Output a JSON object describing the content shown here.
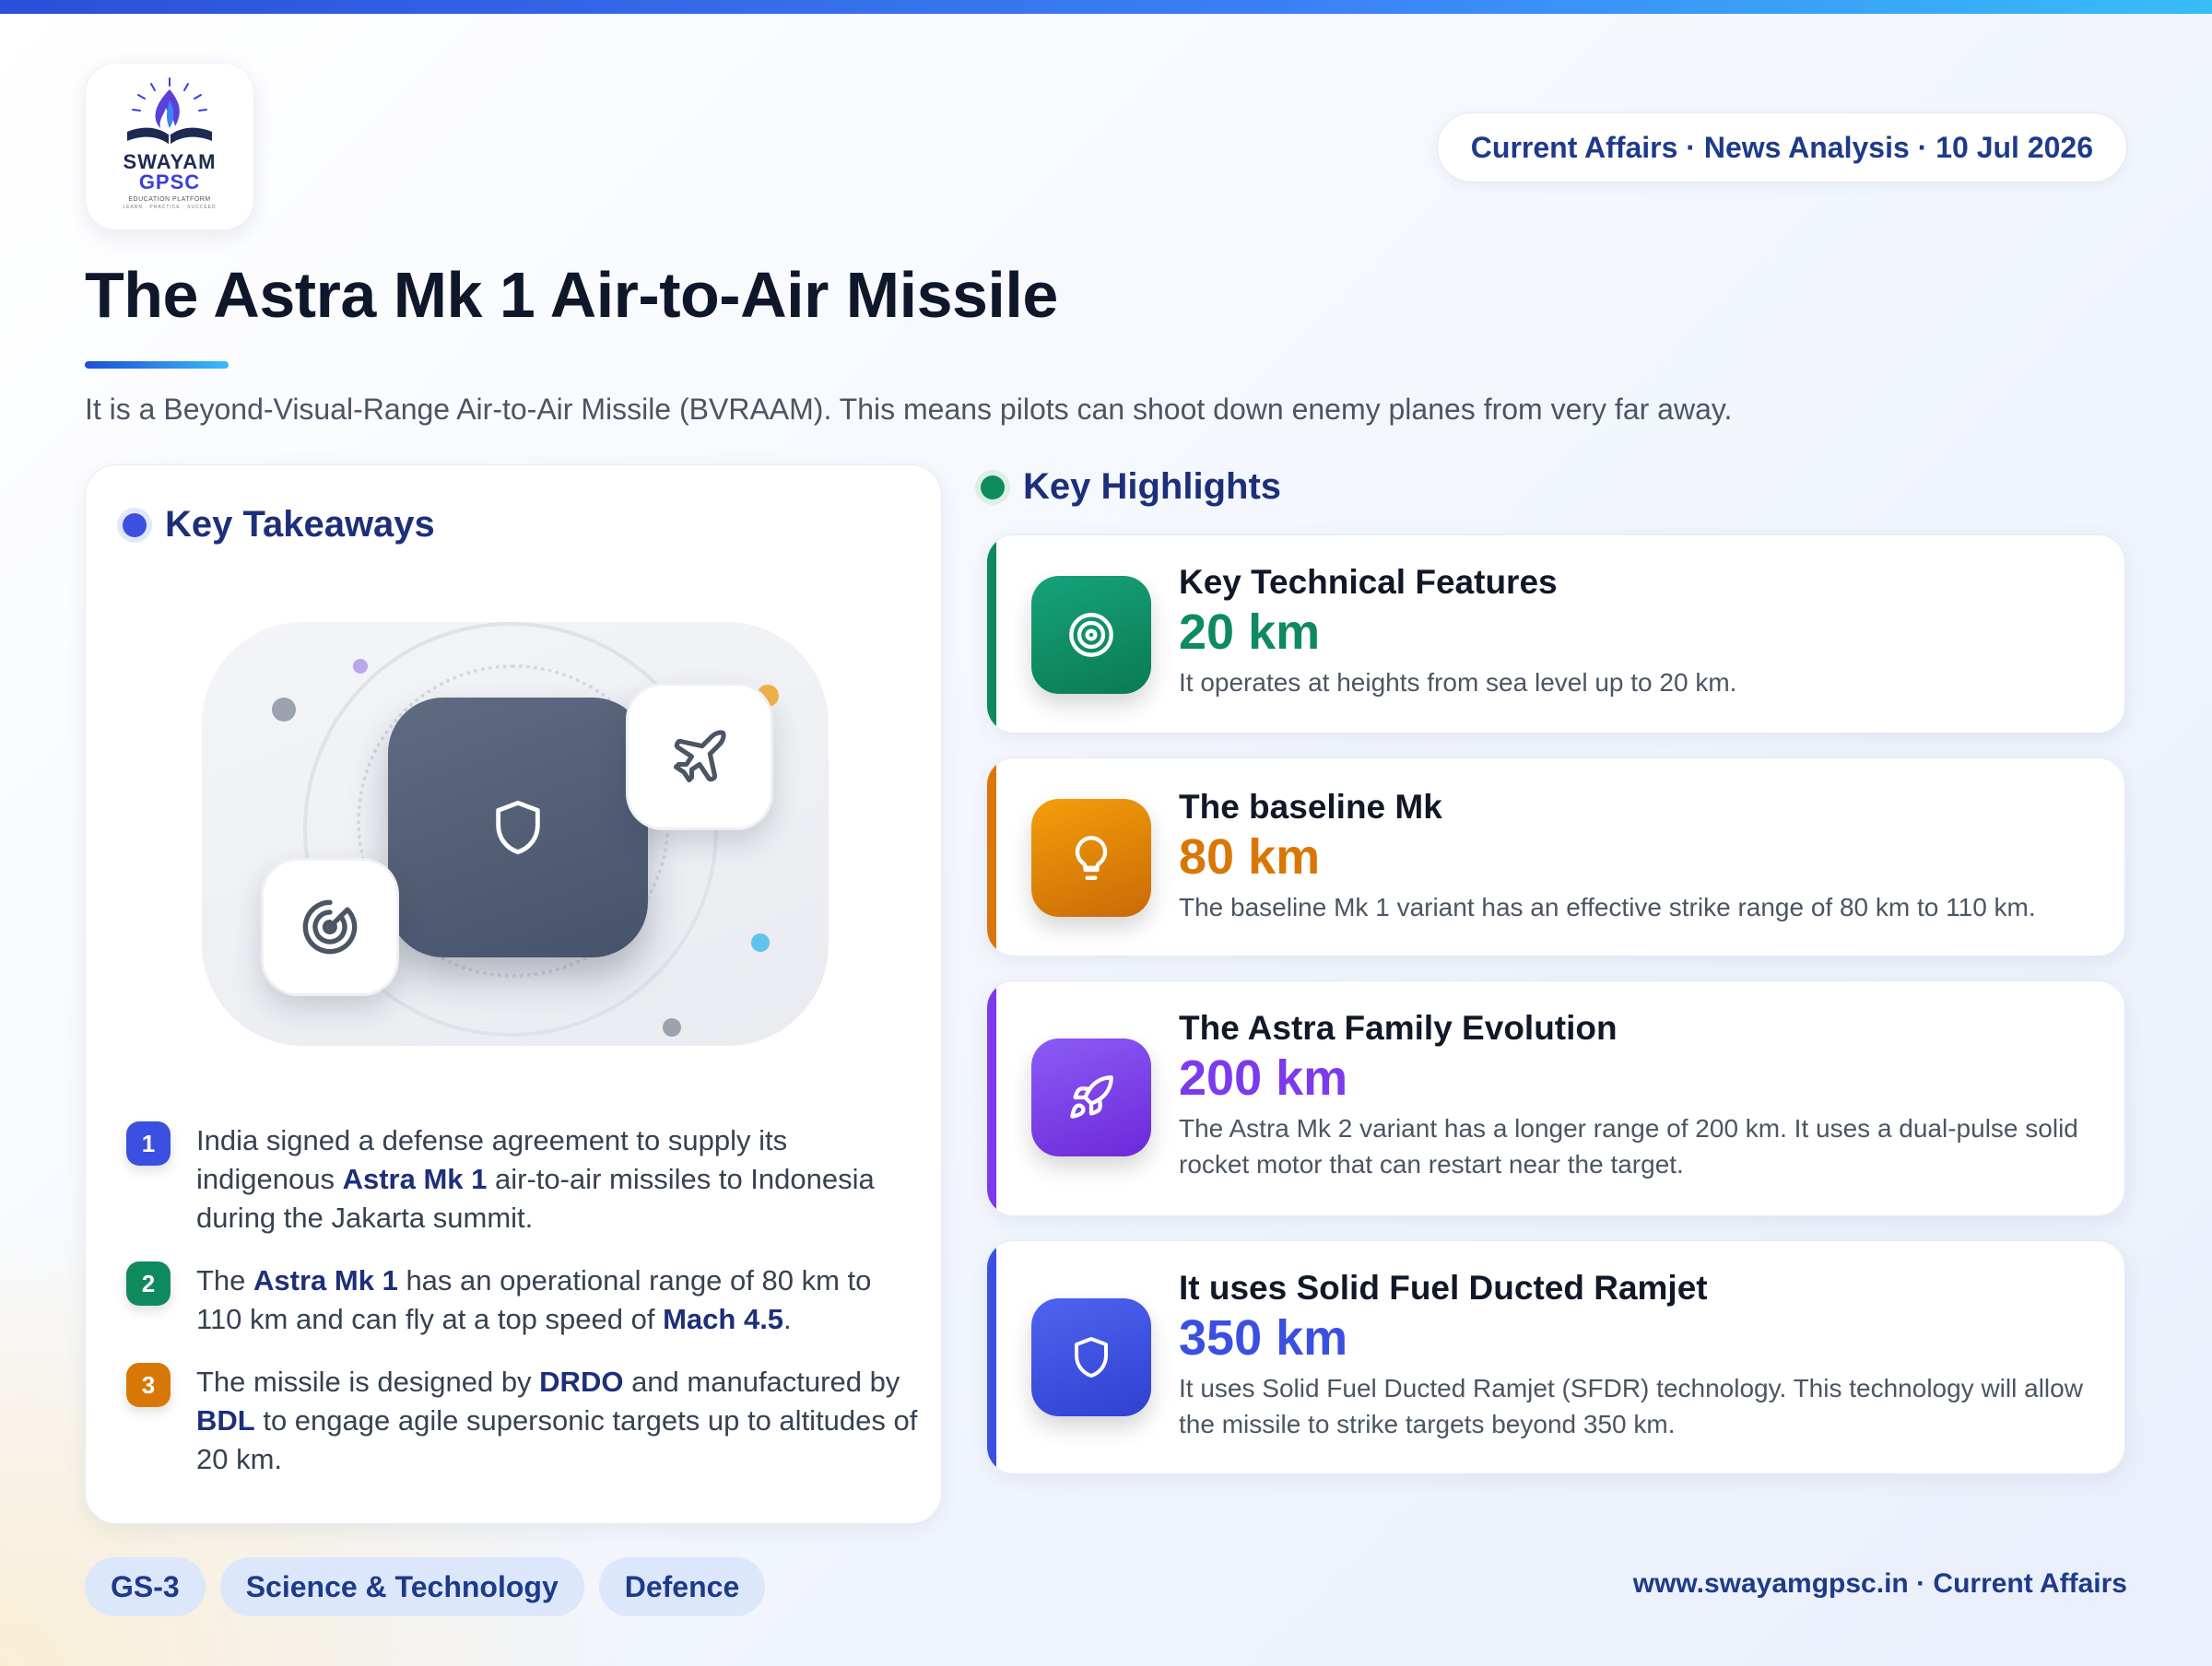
{
  "header": {
    "logo": {
      "line1": "SWAYAM",
      "line2": "GPSC",
      "line3": "EDUCATION PLATFORM",
      "line4": "LEARN · PRACTICE · SUCCEED"
    },
    "date_pill": "Current Affairs · News Analysis · 10 Jul 2026",
    "title": "The Astra Mk 1 Air-to-Air Missile",
    "subtitle": "It is a Beyond-Visual-Range Air-to-Air Missile (BVRAAM). This means pilots can shoot down enemy planes from very far away."
  },
  "takeaways": {
    "heading": "Key Takeaways",
    "items": [
      {
        "num": "1",
        "parts": [
          "India signed a defense agreement to supply its indigenous ",
          "Astra Mk 1",
          " air-to-air missiles to Indonesia during the Jakarta summit."
        ]
      },
      {
        "num": "2",
        "parts": [
          "The ",
          "Astra Mk 1",
          " has an operational range of 80 km to 110 km and can fly at a top speed of ",
          "Mach 4.5",
          "."
        ]
      },
      {
        "num": "3",
        "parts": [
          "The missile is designed by ",
          "DRDO",
          " and manufactured by ",
          "BDL",
          " to engage agile supersonic targets up to altitudes of 20 km."
        ]
      }
    ]
  },
  "highlights": {
    "heading": "Key Highlights",
    "items": [
      {
        "title": "Key Technical Features",
        "value": "20 km",
        "desc": "It operates at heights from sea level up to 20 km.",
        "color": "#0f8a5f",
        "icon": "target-icon"
      },
      {
        "title": "The baseline Mk",
        "value": "80 km",
        "desc": "The baseline Mk 1 variant has an effective strike range of 80 km to 110 km.",
        "color": "#d97706",
        "icon": "lightbulb-icon"
      },
      {
        "title": "The Astra Family Evolution",
        "value": "200 km",
        "desc": "The Astra Mk 2 variant has a longer range of 200 km. It uses a dual-pulse solid rocket motor that can restart near the target.",
        "color": "#7c3aed",
        "icon": "rocket-icon"
      },
      {
        "title": "It uses Solid Fuel Ducted Ramjet",
        "value": "350 km",
        "desc": "It uses Solid Fuel Ducted Ramjet (SFDR) technology. This technology will allow the missile to strike targets beyond 350 km.",
        "color": "#3b4fe0",
        "icon": "shield-icon"
      }
    ]
  },
  "footer": {
    "tags": [
      "GS-3",
      "Science & Technology",
      "Defence"
    ],
    "website": "www.swayamgpsc.in · Current Affairs"
  }
}
